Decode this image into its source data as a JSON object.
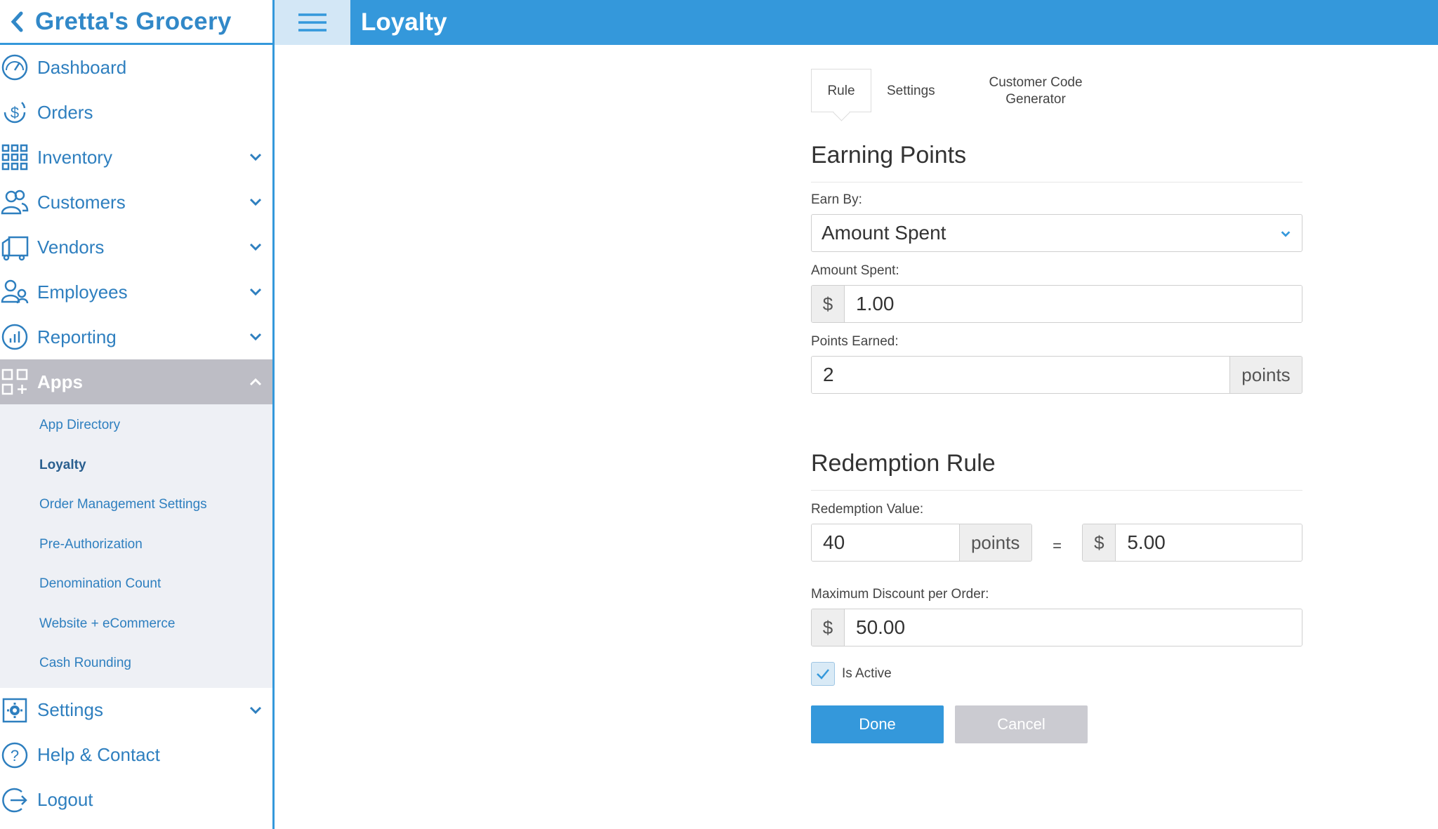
{
  "brand": {
    "title": "Gretta's Grocery"
  },
  "header": {
    "title": "Loyalty"
  },
  "sidebar": {
    "items": [
      {
        "label": "Dashboard",
        "icon": "dashboard-icon"
      },
      {
        "label": "Orders",
        "icon": "orders-icon"
      },
      {
        "label": "Inventory",
        "icon": "inventory-icon",
        "expandable": true
      },
      {
        "label": "Customers",
        "icon": "customers-icon",
        "expandable": true
      },
      {
        "label": "Vendors",
        "icon": "vendors-icon",
        "expandable": true
      },
      {
        "label": "Employees",
        "icon": "employees-icon",
        "expandable": true
      },
      {
        "label": "Reporting",
        "icon": "reporting-icon",
        "expandable": true
      },
      {
        "label": "Apps",
        "icon": "apps-icon",
        "expanded": true
      },
      {
        "label": "Settings",
        "icon": "settings-icon",
        "expandable": true
      },
      {
        "label": "Help & Contact",
        "icon": "help-icon"
      },
      {
        "label": "Logout",
        "icon": "logout-icon"
      }
    ],
    "apps_sub": [
      "App Directory",
      "Loyalty",
      "Order Management Settings",
      "Pre-Authorization",
      "Denomination Count",
      "Website + eCommerce",
      "Cash Rounding"
    ],
    "current_sub": "Loyalty"
  },
  "tabs": {
    "rule": "Rule",
    "settings": "Settings",
    "code_line1": "Customer Code",
    "code_line2": "Generator",
    "active": "Rule"
  },
  "earning": {
    "title": "Earning Points",
    "earn_by_label": "Earn By:",
    "earn_by_value": "Amount Spent",
    "amount_label": "Amount Spent:",
    "amount_prefix": "$",
    "amount_value": "1.00",
    "points_label": "Points Earned:",
    "points_value": "2",
    "points_suffix": "points"
  },
  "redemption": {
    "title": "Redemption Rule",
    "value_label": "Redemption Value:",
    "points_value": "40",
    "points_suffix": "points",
    "equals": "=",
    "dollar_prefix": "$",
    "dollar_value": "5.00",
    "max_label": "Maximum Discount per Order:",
    "max_prefix": "$",
    "max_value": "50.00",
    "active_label": "Is Active",
    "is_active": true
  },
  "actions": {
    "done": "Done",
    "cancel": "Cancel"
  },
  "colors": {
    "primary": "#3498db",
    "link": "#2e7fbf",
    "active_nav": "#bdbdc5"
  }
}
